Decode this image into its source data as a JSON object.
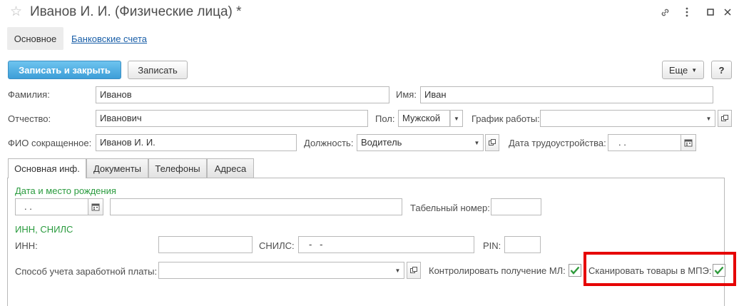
{
  "window": {
    "title": "Иванов И. И. (Физические лица) *"
  },
  "sections": {
    "main": "Основное",
    "bank_accounts": "Банковские счета"
  },
  "toolbar": {
    "save_close": "Записать и закрыть",
    "save": "Записать",
    "more": "Еще",
    "help": "?"
  },
  "form": {
    "lastname_label": "Фамилия:",
    "lastname_value": "Иванов",
    "firstname_label": "Имя:",
    "firstname_value": "Иван",
    "patronymic_label": "Отчество:",
    "patronymic_value": "Иванович",
    "gender_label": "Пол:",
    "gender_value": "Мужской",
    "schedule_label": "График работы:",
    "schedule_value": "",
    "short_name_label": "ФИО сокращенное:",
    "short_name_value": "Иванов И. И.",
    "position_label": "Должность:",
    "position_value": "Водитель",
    "hire_date_label": "Дата трудоустройства:",
    "hire_date_value": ". ."
  },
  "tabs": [
    {
      "label": "Основная инф."
    },
    {
      "label": "Документы"
    },
    {
      "label": "Телефоны"
    },
    {
      "label": "Адреса"
    }
  ],
  "main_tab": {
    "birth_group": "Дата и место рождения",
    "birth_date_value": ". .",
    "birth_place_value": "",
    "tab_number_label": "Табельный номер:",
    "tab_number_value": "",
    "inn_group": "ИНН, СНИЛС",
    "inn_label": "ИНН:",
    "inn_value": "",
    "snils_label": "СНИЛС:",
    "snils_value": "-   -",
    "pin_label": "PIN:",
    "pin_value": "",
    "salary_method_label": "Способ учета заработной платы:",
    "salary_method_value": "",
    "control_ml_label": "Контролировать получение МЛ:",
    "control_ml_checked": true,
    "scan_goods_label": "Сканировать товары в МПЭ:",
    "scan_goods_checked": true
  },
  "colors": {
    "primary_button": "#3d9ed8",
    "group_header": "#2a9b3e",
    "link": "#1a5fa8",
    "highlight": "#e60000",
    "check": "#2e9a3b"
  },
  "icons": {
    "star": "star-icon",
    "link": "link-icon",
    "menu": "more-vertical-icon",
    "maximize": "maximize-icon",
    "close": "close-icon",
    "dropdown": "chevron-down-icon",
    "calendar": "calendar-icon",
    "open": "open-icon",
    "checkmark": "checkmark-icon"
  }
}
